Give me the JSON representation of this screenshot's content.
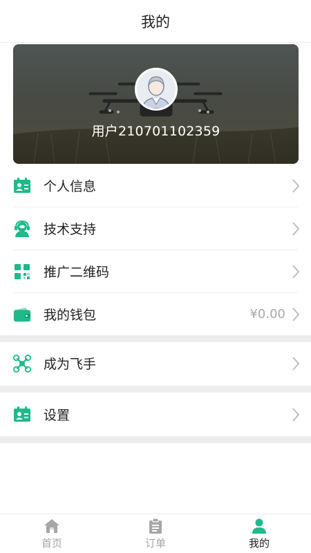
{
  "header": {
    "title": "我的"
  },
  "profile": {
    "username": "用户210701102359"
  },
  "menu": {
    "personal_info": {
      "label": "个人信息",
      "icon": "id-card-icon"
    },
    "tech_support": {
      "label": "技术支持",
      "icon": "support-agent-icon"
    },
    "promo_qrcode": {
      "label": "推广二维码",
      "icon": "qrcode-icon"
    },
    "wallet": {
      "label": "我的钱包",
      "value": "¥0.00",
      "icon": "wallet-icon"
    },
    "become_pilot": {
      "label": "成为飞手",
      "icon": "drone-icon"
    },
    "settings": {
      "label": "设置",
      "icon": "id-card-icon"
    }
  },
  "tabbar": {
    "tabs": [
      {
        "label": "首页",
        "icon": "home-icon",
        "active": false
      },
      {
        "label": "订单",
        "icon": "clipboard-icon",
        "active": false
      },
      {
        "label": "我的",
        "icon": "person-icon",
        "active": true
      }
    ]
  },
  "colors": {
    "accent": "#1fb98a",
    "inactive": "#a6a6a6",
    "separator": "#ededed"
  }
}
